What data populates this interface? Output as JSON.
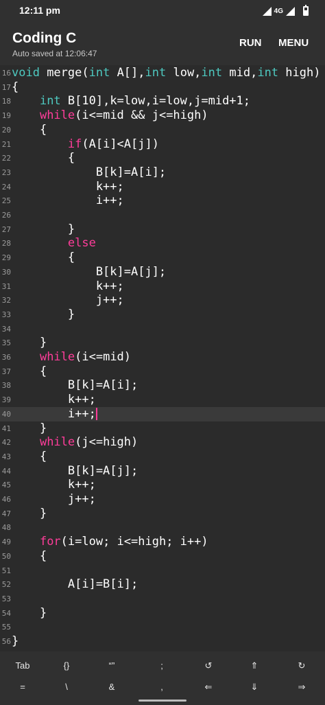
{
  "status": {
    "time": "12:11 pm",
    "network": "4G"
  },
  "app": {
    "title": "Coding C",
    "subtitle": "Auto saved at 12:06:47",
    "run_label": "RUN",
    "menu_label": "MENU"
  },
  "colors": {
    "background": "#2b2b2b",
    "bar": "#303030",
    "keyword": "#4ec9c0",
    "control": "#ff3d9a",
    "line_number": "#9a9a9a"
  },
  "editor": {
    "active_line": 40,
    "lines": [
      {
        "n": "16",
        "tokens": [
          {
            "t": "void",
            "c": "kw"
          },
          {
            "t": " merge("
          },
          {
            "t": "int",
            "c": "kw"
          },
          {
            "t": " A[],"
          },
          {
            "t": "int",
            "c": "kw"
          },
          {
            "t": " low,"
          },
          {
            "t": "int",
            "c": "kw"
          },
          {
            "t": " mid,"
          },
          {
            "t": "int",
            "c": "kw"
          },
          {
            "t": " high)"
          }
        ]
      },
      {
        "n": "17",
        "tokens": [
          {
            "t": "{"
          }
        ]
      },
      {
        "n": "18",
        "tokens": [
          {
            "t": "    "
          },
          {
            "t": "int",
            "c": "kw"
          },
          {
            "t": " B[10],k=low,i=low,j=mid+1;"
          }
        ]
      },
      {
        "n": "19",
        "tokens": [
          {
            "t": "    "
          },
          {
            "t": "while",
            "c": "ctrl"
          },
          {
            "t": "(i<=mid && j<=high)"
          }
        ]
      },
      {
        "n": "20",
        "tokens": [
          {
            "t": "    {"
          }
        ]
      },
      {
        "n": "21",
        "tokens": [
          {
            "t": "        "
          },
          {
            "t": "if",
            "c": "ctrl"
          },
          {
            "t": "(A[i]<A[j])"
          }
        ]
      },
      {
        "n": "22",
        "tokens": [
          {
            "t": "        {"
          }
        ]
      },
      {
        "n": "23",
        "tokens": [
          {
            "t": "            B[k]=A[i];"
          }
        ]
      },
      {
        "n": "24",
        "tokens": [
          {
            "t": "            k++;"
          }
        ]
      },
      {
        "n": "25",
        "tokens": [
          {
            "t": "            i++;"
          }
        ]
      },
      {
        "n": "26",
        "tokens": []
      },
      {
        "n": "27",
        "tokens": [
          {
            "t": "        }"
          }
        ]
      },
      {
        "n": "28",
        "tokens": [
          {
            "t": "        "
          },
          {
            "t": "else",
            "c": "ctrl"
          }
        ]
      },
      {
        "n": "29",
        "tokens": [
          {
            "t": "        {"
          }
        ]
      },
      {
        "n": "30",
        "tokens": [
          {
            "t": "            B[k]=A[j];"
          }
        ]
      },
      {
        "n": "31",
        "tokens": [
          {
            "t": "            k++;"
          }
        ]
      },
      {
        "n": "32",
        "tokens": [
          {
            "t": "            j++;"
          }
        ]
      },
      {
        "n": "33",
        "tokens": [
          {
            "t": "        }"
          }
        ]
      },
      {
        "n": "34",
        "tokens": []
      },
      {
        "n": "35",
        "tokens": [
          {
            "t": "    }"
          }
        ]
      },
      {
        "n": "36",
        "tokens": [
          {
            "t": "    "
          },
          {
            "t": "while",
            "c": "ctrl"
          },
          {
            "t": "(i<=mid)"
          }
        ]
      },
      {
        "n": "37",
        "tokens": [
          {
            "t": "    {"
          }
        ]
      },
      {
        "n": "38",
        "tokens": [
          {
            "t": "        B[k]=A[i];"
          }
        ]
      },
      {
        "n": "39",
        "tokens": [
          {
            "t": "        k++;"
          }
        ]
      },
      {
        "n": "40",
        "tokens": [
          {
            "t": "        i++;"
          }
        ]
      },
      {
        "n": "41",
        "tokens": [
          {
            "t": "    }"
          }
        ]
      },
      {
        "n": "42",
        "tokens": [
          {
            "t": "    "
          },
          {
            "t": "while",
            "c": "ctrl"
          },
          {
            "t": "(j<=high)"
          }
        ]
      },
      {
        "n": "43",
        "tokens": [
          {
            "t": "    {"
          }
        ]
      },
      {
        "n": "44",
        "tokens": [
          {
            "t": "        B[k]=A[j];"
          }
        ]
      },
      {
        "n": "45",
        "tokens": [
          {
            "t": "        k++;"
          }
        ]
      },
      {
        "n": "46",
        "tokens": [
          {
            "t": "        j++;"
          }
        ]
      },
      {
        "n": "47",
        "tokens": [
          {
            "t": "    }"
          }
        ]
      },
      {
        "n": "48",
        "tokens": []
      },
      {
        "n": "49",
        "tokens": [
          {
            "t": "    "
          },
          {
            "t": "for",
            "c": "ctrl"
          },
          {
            "t": "(i=low; i<=high; i++)"
          }
        ]
      },
      {
        "n": "50",
        "tokens": [
          {
            "t": "    {"
          }
        ]
      },
      {
        "n": "51",
        "tokens": []
      },
      {
        "n": "52",
        "tokens": [
          {
            "t": "        A[i]=B[i];"
          }
        ]
      },
      {
        "n": "53",
        "tokens": []
      },
      {
        "n": "54",
        "tokens": [
          {
            "t": "    }"
          }
        ]
      },
      {
        "n": "55",
        "tokens": []
      },
      {
        "n": "56",
        "tokens": [
          {
            "t": "}"
          }
        ]
      }
    ]
  },
  "keys": {
    "row1": [
      {
        "label": "Tab",
        "name": "tab-key"
      },
      {
        "label": "{}",
        "name": "braces-key"
      },
      {
        "label": "“”",
        "name": "quotes-key"
      },
      {
        "label": ";",
        "name": "semicolon-key"
      },
      {
        "label": "↺",
        "name": "undo-icon"
      },
      {
        "label": "⇑",
        "name": "arrow-up-icon"
      },
      {
        "label": "↻",
        "name": "redo-icon"
      }
    ],
    "row2": [
      {
        "label": "=",
        "name": "equals-key"
      },
      {
        "label": "\\",
        "name": "backslash-key"
      },
      {
        "label": "&",
        "name": "ampersand-key"
      },
      {
        "label": ",",
        "name": "comma-key"
      },
      {
        "label": "⇐",
        "name": "arrow-left-icon"
      },
      {
        "label": "⇓",
        "name": "arrow-down-icon"
      },
      {
        "label": "⇒",
        "name": "arrow-right-icon"
      }
    ]
  }
}
